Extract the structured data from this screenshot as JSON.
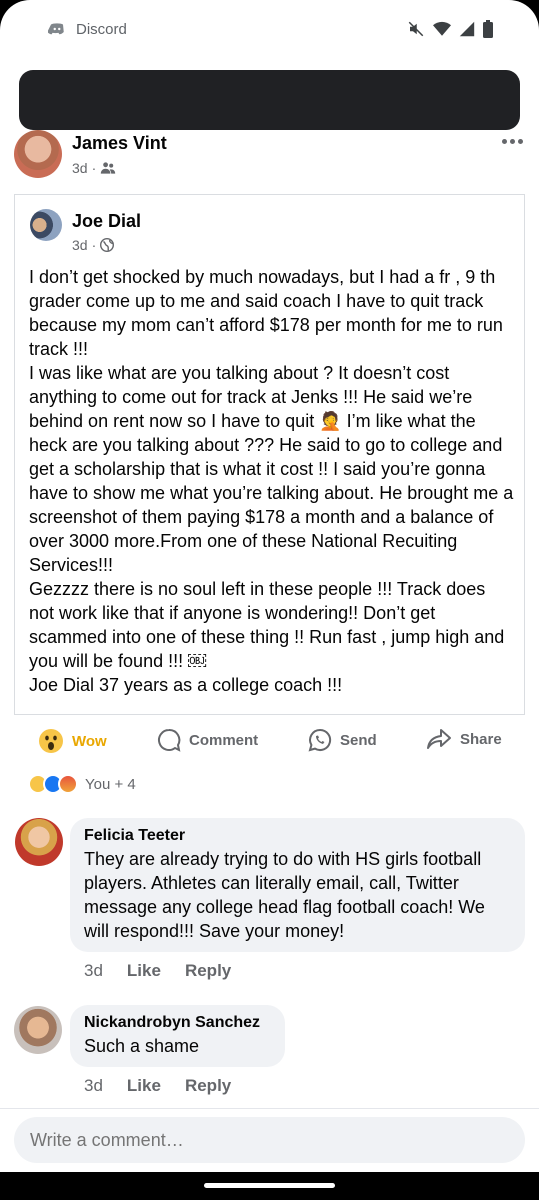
{
  "status_bar": {
    "app_name": "Discord",
    "icons": [
      "discord-icon",
      "mute-icon",
      "wifi-icon",
      "signal-icon",
      "battery-icon"
    ]
  },
  "post": {
    "author": "James Vint",
    "time": "3d",
    "audience_icon": "friends-icon"
  },
  "shared_post": {
    "author": "Joe Dial",
    "time": "3d",
    "audience_icon": "globe-icon",
    "text": "I don’t get shocked by much nowadays, but I had a fr , 9 th grader come up to me and said coach I have to quit track because my mom can’t afford $178 per month for me to run track !!!\nI was like what are you talking about ? It doesn’t cost anything to come out for track at Jenks !!! He said we’re behind on rent now so I have to quit 🤦 I’m like what the heck are you talking about ??? He said to go to college and get a scholarship that is what it cost !! I said you’re gonna have to show me what you’re talking about. He brought me a screenshot of them paying $178 a month and a balance of over 3000 more.From one of these National Recuiting Services!!!\nGezzzz there is no soul left in these people !!! Track does not work like that if anyone is wondering!! Don’t get scammed into one of these thing !! Run fast , jump high and you will be found !!! ￼\nJoe Dial 37 years as a college coach !!!"
  },
  "actions": {
    "wow": "Wow",
    "comment": "Comment",
    "send": "Send",
    "share": "Share"
  },
  "reactions": {
    "types": [
      "wow",
      "like",
      "angry"
    ],
    "summary": "You + 4"
  },
  "comments": [
    {
      "name": "Felicia Teeter",
      "text": "They are already trying to do with HS girls football players. Athletes can literally email, call, Twitter message any college head flag football coach!  We will respond!!! Save your money!",
      "time": "3d",
      "like": "Like",
      "reply": "Reply"
    },
    {
      "name": "Nickandrobyn Sanchez",
      "text": "Such a shame",
      "time": "3d",
      "like": "Like",
      "reply": "Reply"
    }
  ],
  "composer": {
    "placeholder": "Write a comment…"
  }
}
